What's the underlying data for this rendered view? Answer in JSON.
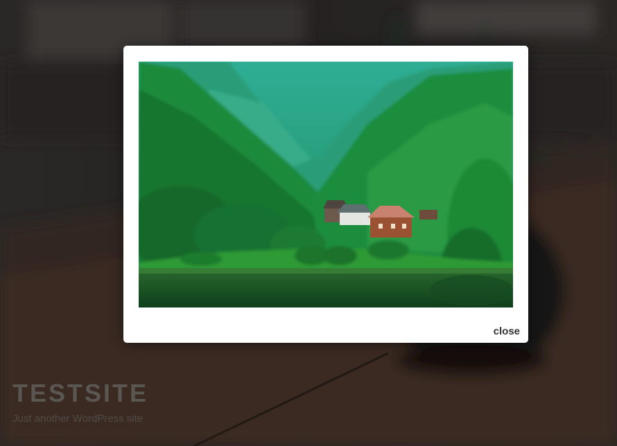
{
  "site": {
    "title": "TESTSITE",
    "tagline": "Just another WordPress site"
  },
  "lightbox": {
    "close_label": "close",
    "image": {
      "subject": "landscape-photo",
      "description": "green forested mountains, houses by a lake"
    }
  },
  "colors": {
    "backdrop": "#1c1a18",
    "lightbox_bg": "#ffffff",
    "close_text": "#333333",
    "site_title": "#5a5652"
  }
}
